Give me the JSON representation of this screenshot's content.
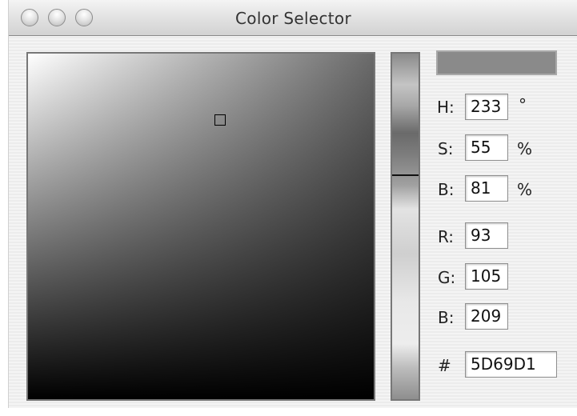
{
  "window": {
    "title": "Color Selector"
  },
  "selected_color": {
    "hex_color": "#5D69D1",
    "swatch_display_gray": "#8a8a8a"
  },
  "fields": {
    "h": {
      "label": "H:",
      "value": "233",
      "unit": "°"
    },
    "s": {
      "label": "S:",
      "value": "55",
      "unit": "%"
    },
    "b_hsb": {
      "label": "B:",
      "value": "81",
      "unit": "%"
    },
    "r": {
      "label": "R:",
      "value": "93"
    },
    "g": {
      "label": "G:",
      "value": "105"
    },
    "b_rgb": {
      "label": "B:",
      "value": "209"
    },
    "hex": {
      "label": "#",
      "value": "5D69D1"
    }
  },
  "icons": {
    "close": "close-button-icon",
    "minimize": "minimize-button-icon",
    "zoom": "zoom-button-icon"
  }
}
